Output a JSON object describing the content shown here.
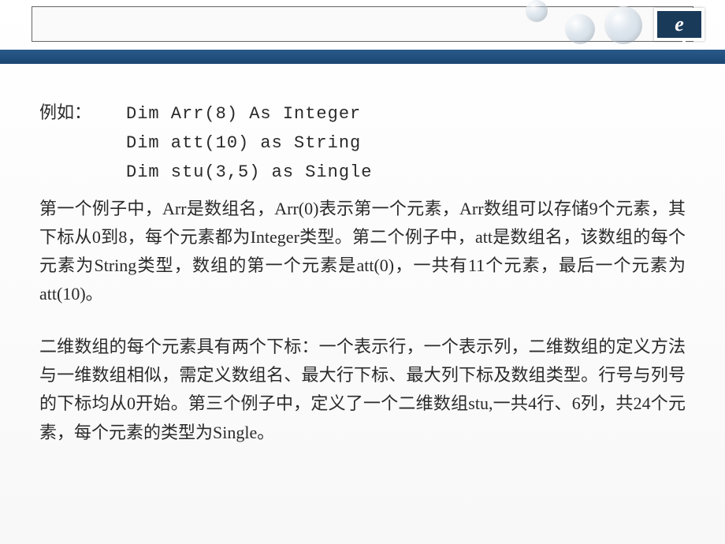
{
  "header": {
    "logo_letter": "e"
  },
  "content": {
    "example_label": "例如：",
    "code_lines": [
      "Dim Arr(8) As Integer",
      "Dim att(10) as String",
      "Dim stu(3,5) as Single"
    ],
    "paragraph1": "第一个例子中，Arr是数组名，Arr(0)表示第一个元素，Arr数组可以存储9个元素，其下标从0到8，每个元素都为Integer类型。第二个例子中，att是数组名，该数组的每个元素为String类型，数组的第一个元素是att(0)，一共有11个元素，最后一个元素为att(10)。",
    "paragraph2": "二维数组的每个元素具有两个下标：一个表示行，一个表示列，二维数组的定义方法与一维数组相似，需定义数组名、最大行下标、最大列下标及数组类型。行号与列号的下标均从0开始。第三个例子中，定义了一个二维数组stu,一共4行、6列，共24个元素，每个元素的类型为Single。"
  }
}
